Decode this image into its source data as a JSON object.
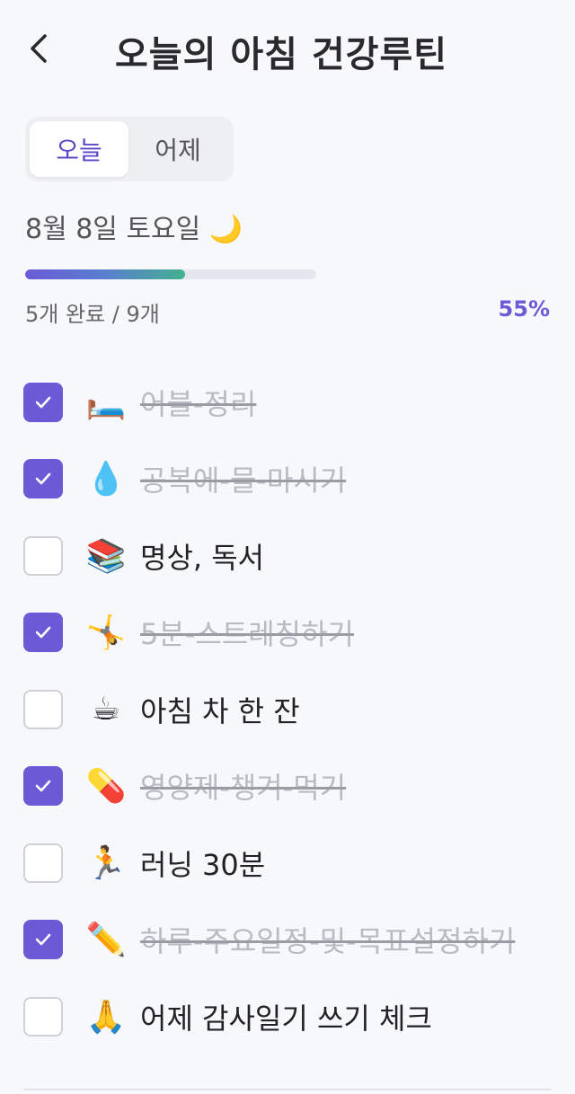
{
  "header": {
    "back_icon": "chevron-left-icon",
    "title": "오늘의 아침 건강루틴"
  },
  "tabs": [
    {
      "label": "오늘",
      "active": true
    },
    {
      "label": "어제",
      "active": false
    }
  ],
  "date": {
    "label": "8월 8일 토요일 🌙"
  },
  "progress": {
    "fraction": 0.55,
    "count_text": "5개 완료 / 9개",
    "percent_text": "55%"
  },
  "colors": {
    "accent": "#6a5ad6",
    "done_text": "#b9bbc3",
    "background": "#f7f8fc"
  },
  "tasks": [
    {
      "emoji": "🛏️",
      "label": "어불-정리",
      "done": true
    },
    {
      "emoji": "💧",
      "label": "공복에-물-마시기",
      "done": true
    },
    {
      "emoji": "📚",
      "label": "명상, 독서",
      "done": false
    },
    {
      "emoji": "🤸",
      "label": "5분-스트레칭하기",
      "done": true
    },
    {
      "emoji": "☕",
      "label": "아침 차 한 잔",
      "done": false
    },
    {
      "emoji": "💊",
      "label": "영양제-챙겨-먹기",
      "done": true
    },
    {
      "emoji": "🏃",
      "label": "러닝 30분",
      "done": false
    },
    {
      "emoji": "✏️",
      "label": "하루-주요일정-및-목표설정하기",
      "done": true
    },
    {
      "emoji": "🙏",
      "label": "어제 감사일기 쓰기 체크",
      "done": false
    }
  ]
}
